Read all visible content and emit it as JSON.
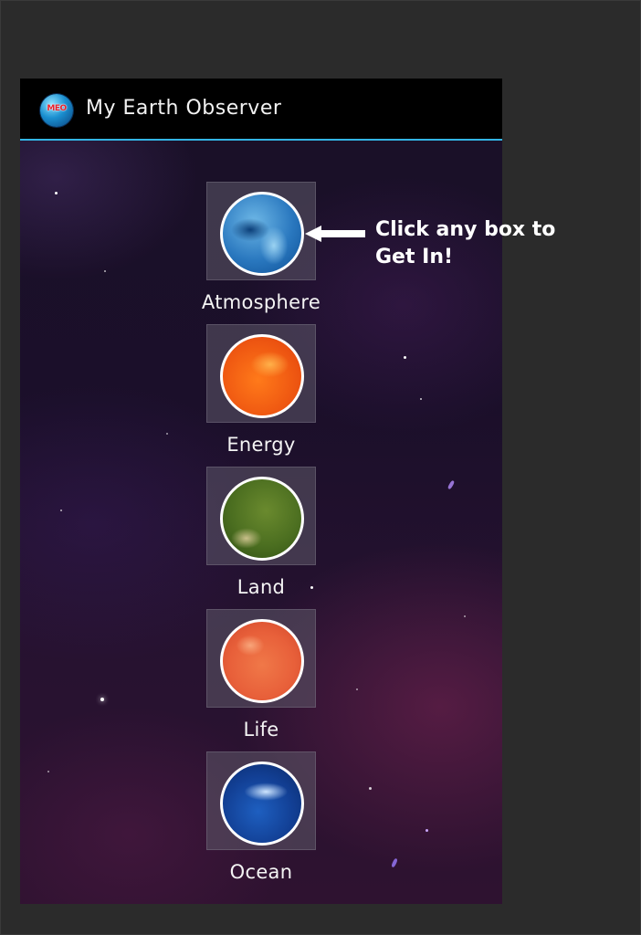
{
  "app": {
    "title": "My Earth Observer",
    "logo_text": "MEO"
  },
  "categories": [
    {
      "label": "Atmosphere",
      "icon": "atmosphere-planet-icon"
    },
    {
      "label": "Energy",
      "icon": "energy-planet-icon"
    },
    {
      "label": "Land",
      "icon": "land-planet-icon"
    },
    {
      "label": "Life",
      "icon": "life-planet-icon"
    },
    {
      "label": "Ocean",
      "icon": "ocean-planet-icon"
    }
  ],
  "callout": {
    "text_line1": "Click any box to",
    "text_line2": "Get In!",
    "icon": "arrow-left-icon"
  },
  "colors": {
    "action_bar_bg": "#000000",
    "action_bar_divider": "#33b5e5",
    "page_bg": "#2b2b2b"
  }
}
